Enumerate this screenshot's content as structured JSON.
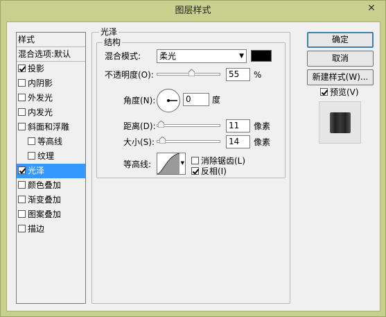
{
  "window": {
    "title": "图层样式",
    "close_label": "✕"
  },
  "style_list": {
    "items": [
      {
        "label": "样式",
        "checkbox": false,
        "checked": false,
        "header": true
      },
      {
        "label": "混合选项:默认",
        "checkbox": false,
        "checked": false,
        "header": true
      },
      {
        "label": "投影",
        "checkbox": true,
        "checked": true
      },
      {
        "label": "内阴影",
        "checkbox": true,
        "checked": false
      },
      {
        "label": "外发光",
        "checkbox": true,
        "checked": false
      },
      {
        "label": "内发光",
        "checkbox": true,
        "checked": false
      },
      {
        "label": "斜面和浮雕",
        "checkbox": true,
        "checked": false
      },
      {
        "label": "等高线",
        "checkbox": true,
        "checked": false,
        "indent": true
      },
      {
        "label": "纹理",
        "checkbox": true,
        "checked": false,
        "indent": true
      },
      {
        "label": "光泽",
        "checkbox": true,
        "checked": true,
        "selected": true
      },
      {
        "label": "颜色叠加",
        "checkbox": true,
        "checked": false
      },
      {
        "label": "渐变叠加",
        "checkbox": true,
        "checked": false
      },
      {
        "label": "图案叠加",
        "checkbox": true,
        "checked": false
      },
      {
        "label": "描边",
        "checkbox": true,
        "checked": false
      }
    ]
  },
  "satin": {
    "group_title": "光泽",
    "structure_title": "结构",
    "blend_mode_label": "混合模式:",
    "blend_mode_value": "柔光",
    "color": "#000000",
    "opacity_label": "不透明度(O):",
    "opacity_value": "55",
    "opacity_unit": "%",
    "opacity_level": 0.55,
    "angle_label": "角度(N):",
    "angle_value": "0",
    "angle_unit": "度",
    "distance_label": "距离(D):",
    "distance_value": "11",
    "distance_unit": "像素",
    "size_label": "大小(S):",
    "size_value": "14",
    "size_unit": "像素",
    "contour_label": "等高线:",
    "antialias_label": "消除锯齿(L)",
    "antialias_checked": false,
    "invert_label": "反相(I)",
    "invert_checked": true
  },
  "buttons": {
    "ok": "确定",
    "cancel": "取消",
    "new_style": "新建样式(W)...",
    "preview_label": "预览(V)",
    "preview_checked": true
  }
}
